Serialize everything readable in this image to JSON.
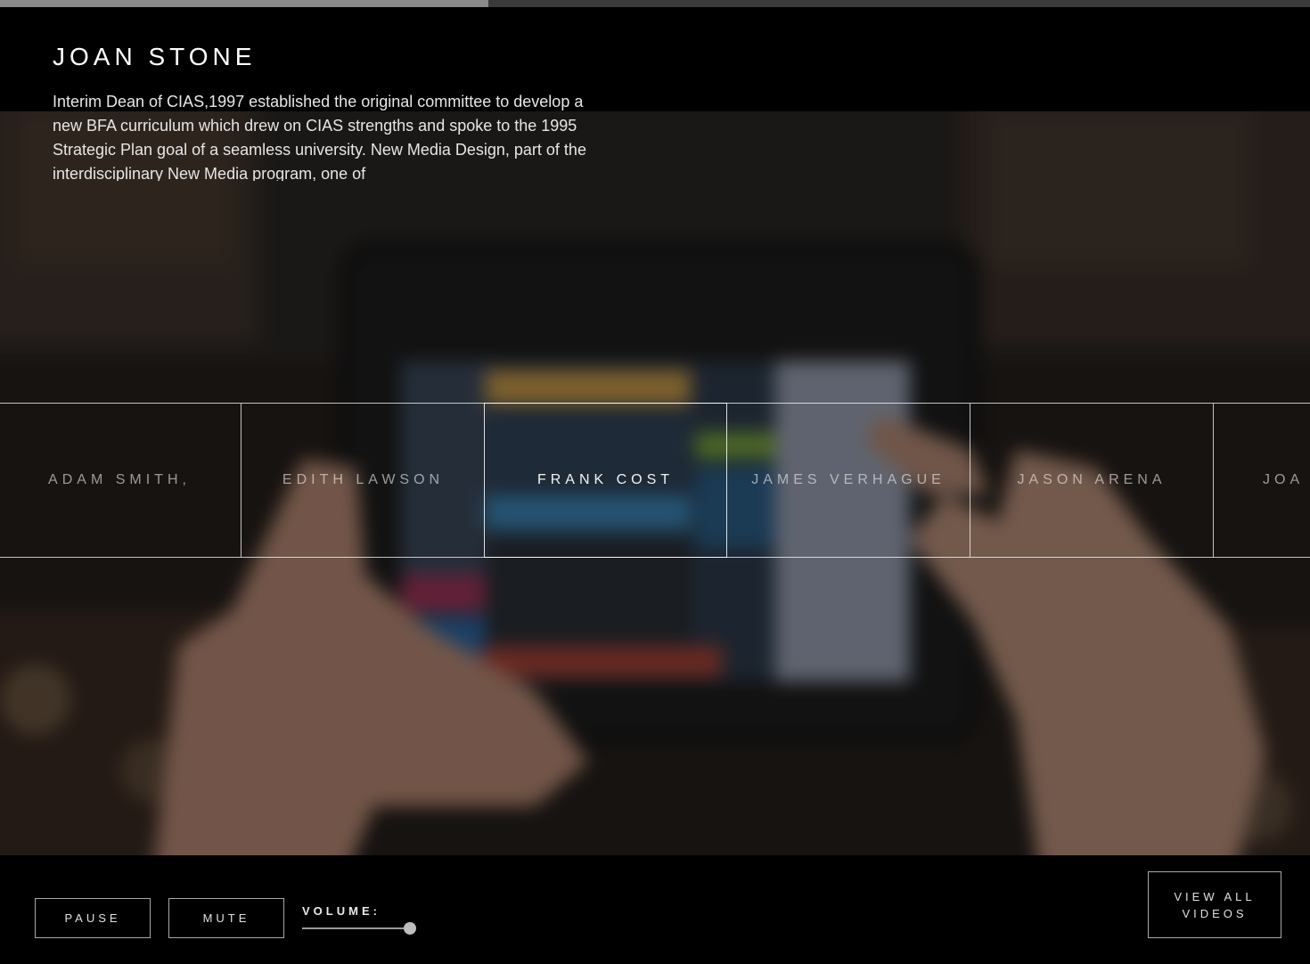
{
  "player": {
    "progress_fraction": 0.373,
    "volume_fraction": 0.99
  },
  "header": {
    "name": "JOAN STONE",
    "bio": "Interim Dean of CIAS,1997 established the original committee to develop a new BFA curriculum which drew on CIAS strengths and spoke to the 1995 Strategic Plan goal of a seamless university. New Media Design, part of the interdisciplinary New Media program, one of"
  },
  "strip": {
    "names": [
      {
        "label": "ADAM SMITH,",
        "active": false
      },
      {
        "label": "EDITH LAWSON",
        "active": false
      },
      {
        "label": "FRANK COST",
        "active": true
      },
      {
        "label": "JAMES VERHAGUE",
        "active": false
      },
      {
        "label": "JASON ARENA",
        "active": false
      },
      {
        "label": "JOA",
        "active": false
      }
    ]
  },
  "controls": {
    "pause_label": "PAUSE",
    "mute_label": "MUTE",
    "volume_label": "VOLUME:",
    "view_all_line1": "VIEW ALL",
    "view_all_line2": "VIDEOS"
  },
  "colors": {
    "background": "#000000",
    "progress_fill": "#8a8a8a",
    "progress_track": "#3a3a3a",
    "text": "#ffffff"
  }
}
